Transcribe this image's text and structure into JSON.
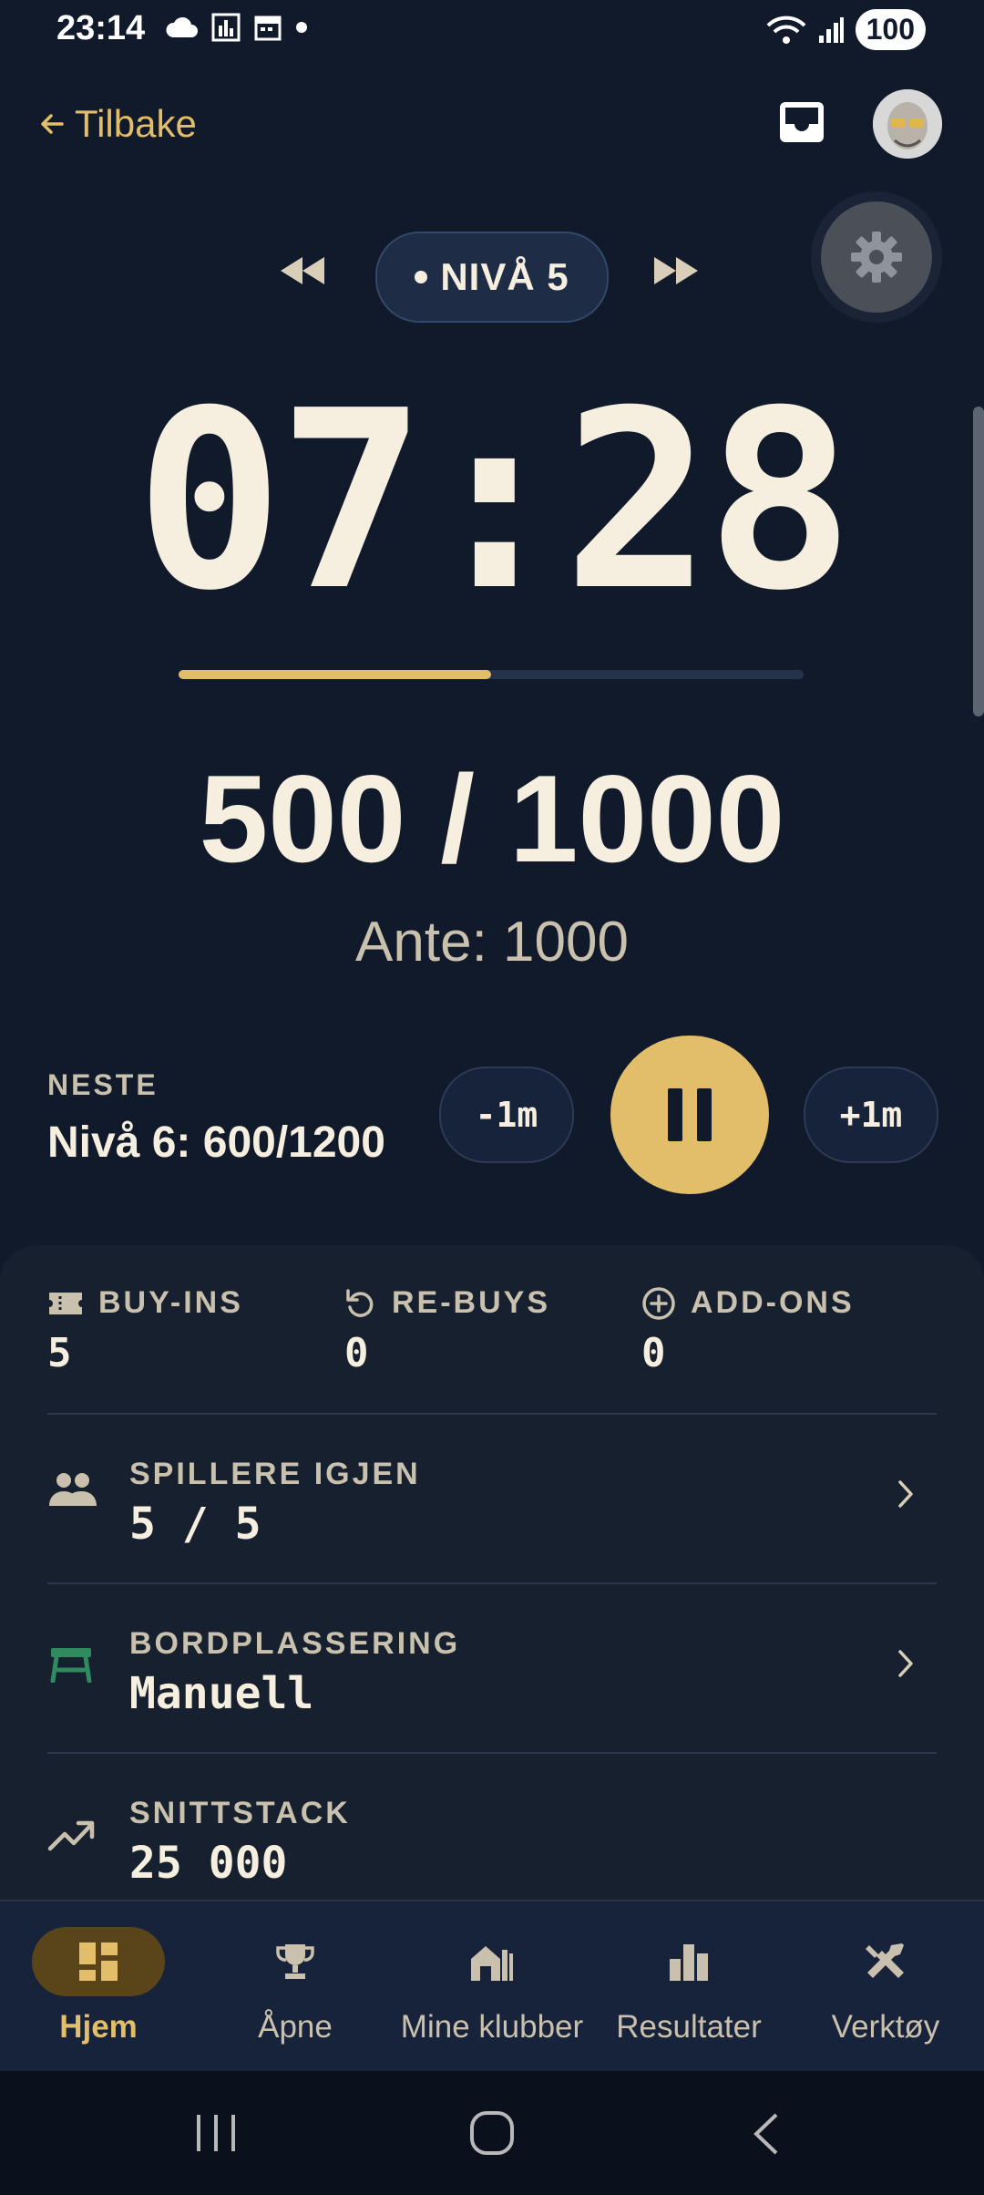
{
  "status_bar": {
    "time": "23:14",
    "battery": "100"
  },
  "header": {
    "back_label": "Tilbake"
  },
  "level": {
    "label": "NIVÅ 5"
  },
  "timer": {
    "display": "07:28",
    "progress_fraction": 0.5
  },
  "blinds": {
    "value": "500 / 1000",
    "ante": "Ante: 1000"
  },
  "next": {
    "label": "NESTE",
    "value": "Nivå 6: 600/1200"
  },
  "controls": {
    "minus": "-1m",
    "plus": "+1m"
  },
  "stats": {
    "buy_ins_label": "BUY-INS",
    "buy_ins_value": "5",
    "rebuys_label": "RE-BUYS",
    "rebuys_value": "0",
    "addons_label": "ADD-ONS",
    "addons_value": "0"
  },
  "rows": {
    "players_label": "SPILLERE IGJEN",
    "players_value": "5 / 5",
    "seating_label": "BORDPLASSERING",
    "seating_value": "Manuell",
    "avgstack_label": "SNITTSTACK",
    "avgstack_value": "25 000"
  },
  "nav": {
    "home": "Hjem",
    "open": "Åpne",
    "clubs": "Mine klubber",
    "results": "Resultater",
    "tools": "Verktøy"
  },
  "colors": {
    "background": "#111a2b",
    "accent": "#e2bd6a",
    "text": "#f6efe0",
    "muted": "#c9c1ad",
    "table_icon": "#2f8a5d"
  }
}
